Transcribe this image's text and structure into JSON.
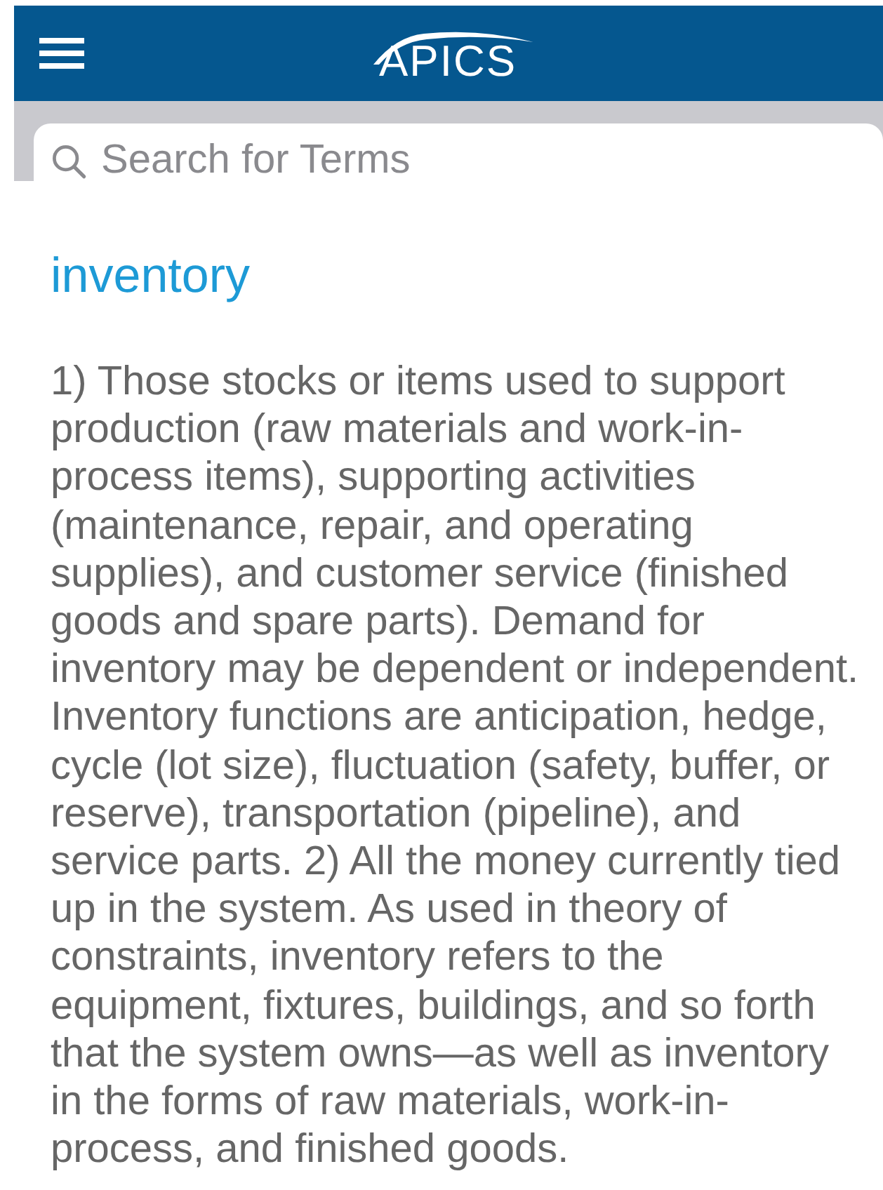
{
  "header": {
    "logo": "APICS"
  },
  "search": {
    "placeholder": "Search for Terms"
  },
  "term": {
    "title": "inventory",
    "definition": "1) Those stocks or items used to support production (raw materials and work-in-process items), supporting activities (maintenance, repair, and operating supplies), and customer service (finished goods and spare parts). Demand for inventory may be dependent or independent. Inventory functions are anticipation, hedge, cycle (lot size), fluctuation (safety, buffer, or reserve), transportation (pipeline), and service parts. 2) All the money currently tied up in the system. As used in theory of constraints, inventory refers to the equipment, fixtures, buildings, and so forth that the system owns—as well as inventory in the forms of raw materials, work-in-process, and finished goods."
  }
}
